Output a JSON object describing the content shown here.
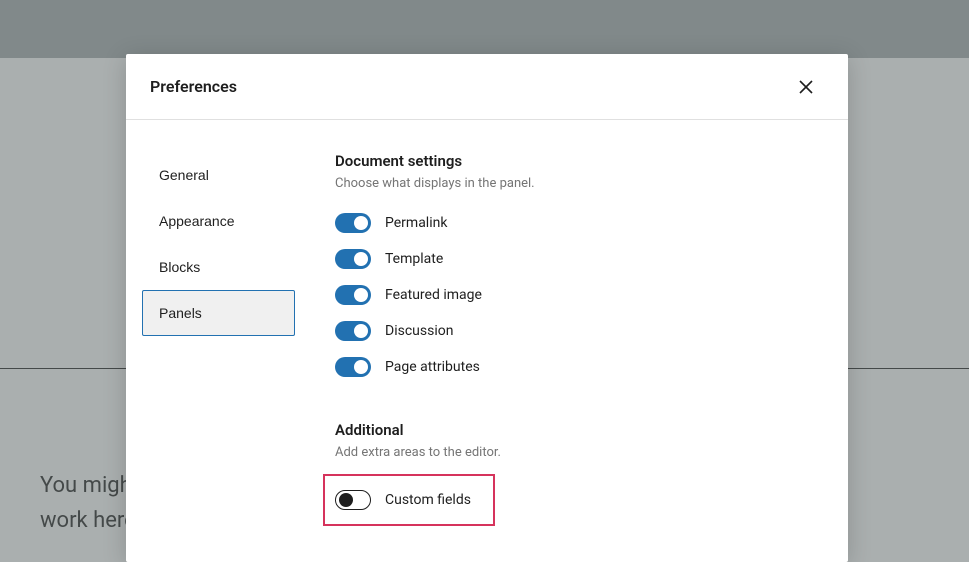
{
  "backdrop": {
    "text_line1": "You migh",
    "text_line2": "work here"
  },
  "modal": {
    "title": "Preferences",
    "nav": {
      "items": [
        {
          "label": "General"
        },
        {
          "label": "Appearance"
        },
        {
          "label": "Blocks"
        },
        {
          "label": "Panels"
        }
      ],
      "active_index": 3
    },
    "sections": [
      {
        "title": "Document settings",
        "subtitle": "Choose what displays in the panel.",
        "toggles": [
          {
            "label": "Permalink",
            "on": true
          },
          {
            "label": "Template",
            "on": true
          },
          {
            "label": "Featured image",
            "on": true
          },
          {
            "label": "Discussion",
            "on": true
          },
          {
            "label": "Page attributes",
            "on": true
          }
        ]
      },
      {
        "title": "Additional",
        "subtitle": "Add extra areas to the editor.",
        "toggles": [
          {
            "label": "Custom fields",
            "on": false,
            "highlighted": true
          }
        ]
      }
    ]
  },
  "colors": {
    "accent": "#2271b1",
    "highlight_border": "#d6335c"
  }
}
